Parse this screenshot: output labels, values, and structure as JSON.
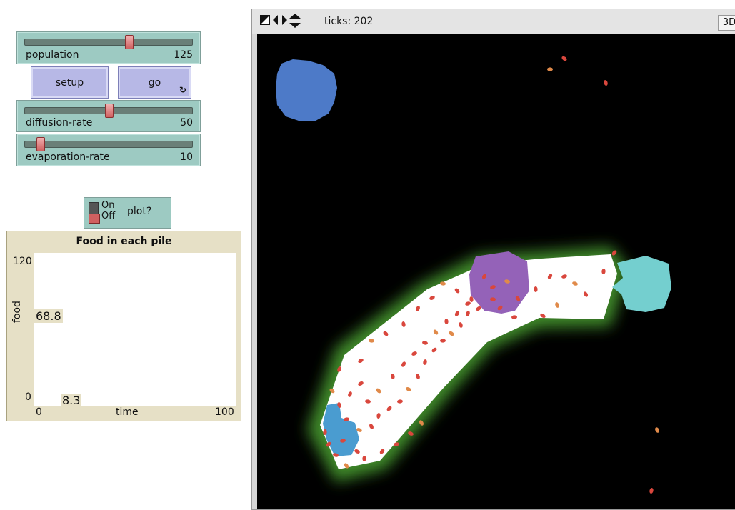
{
  "sliders": [
    {
      "label": "population",
      "value": "125",
      "fraction": 0.62
    },
    {
      "label": "diffusion-rate",
      "value": "50",
      "fraction": 0.5
    },
    {
      "label": "evaporation-rate",
      "value": "10",
      "fraction": 0.1
    }
  ],
  "buttons": {
    "setup": "setup",
    "go": "go",
    "forever_icon": "↻"
  },
  "switch": {
    "on": "On",
    "off": "Off",
    "label": "plot?"
  },
  "plot": {
    "title": "Food in each pile",
    "ymax": "120",
    "ymin": "0",
    "xmin": "0",
    "xmax": "100",
    "xlabel": "time",
    "ylabel": "food",
    "value_a": "68.8",
    "value_b": "8.3"
  },
  "view": {
    "ticks": "ticks: 202",
    "three_d": "3D"
  },
  "colors": {
    "slider": "#9dcac2",
    "button": "#b7b8e6",
    "plot_bg": "#e6e0c6",
    "ant": "#d9473d",
    "ant_food": "#e08a4a"
  }
}
